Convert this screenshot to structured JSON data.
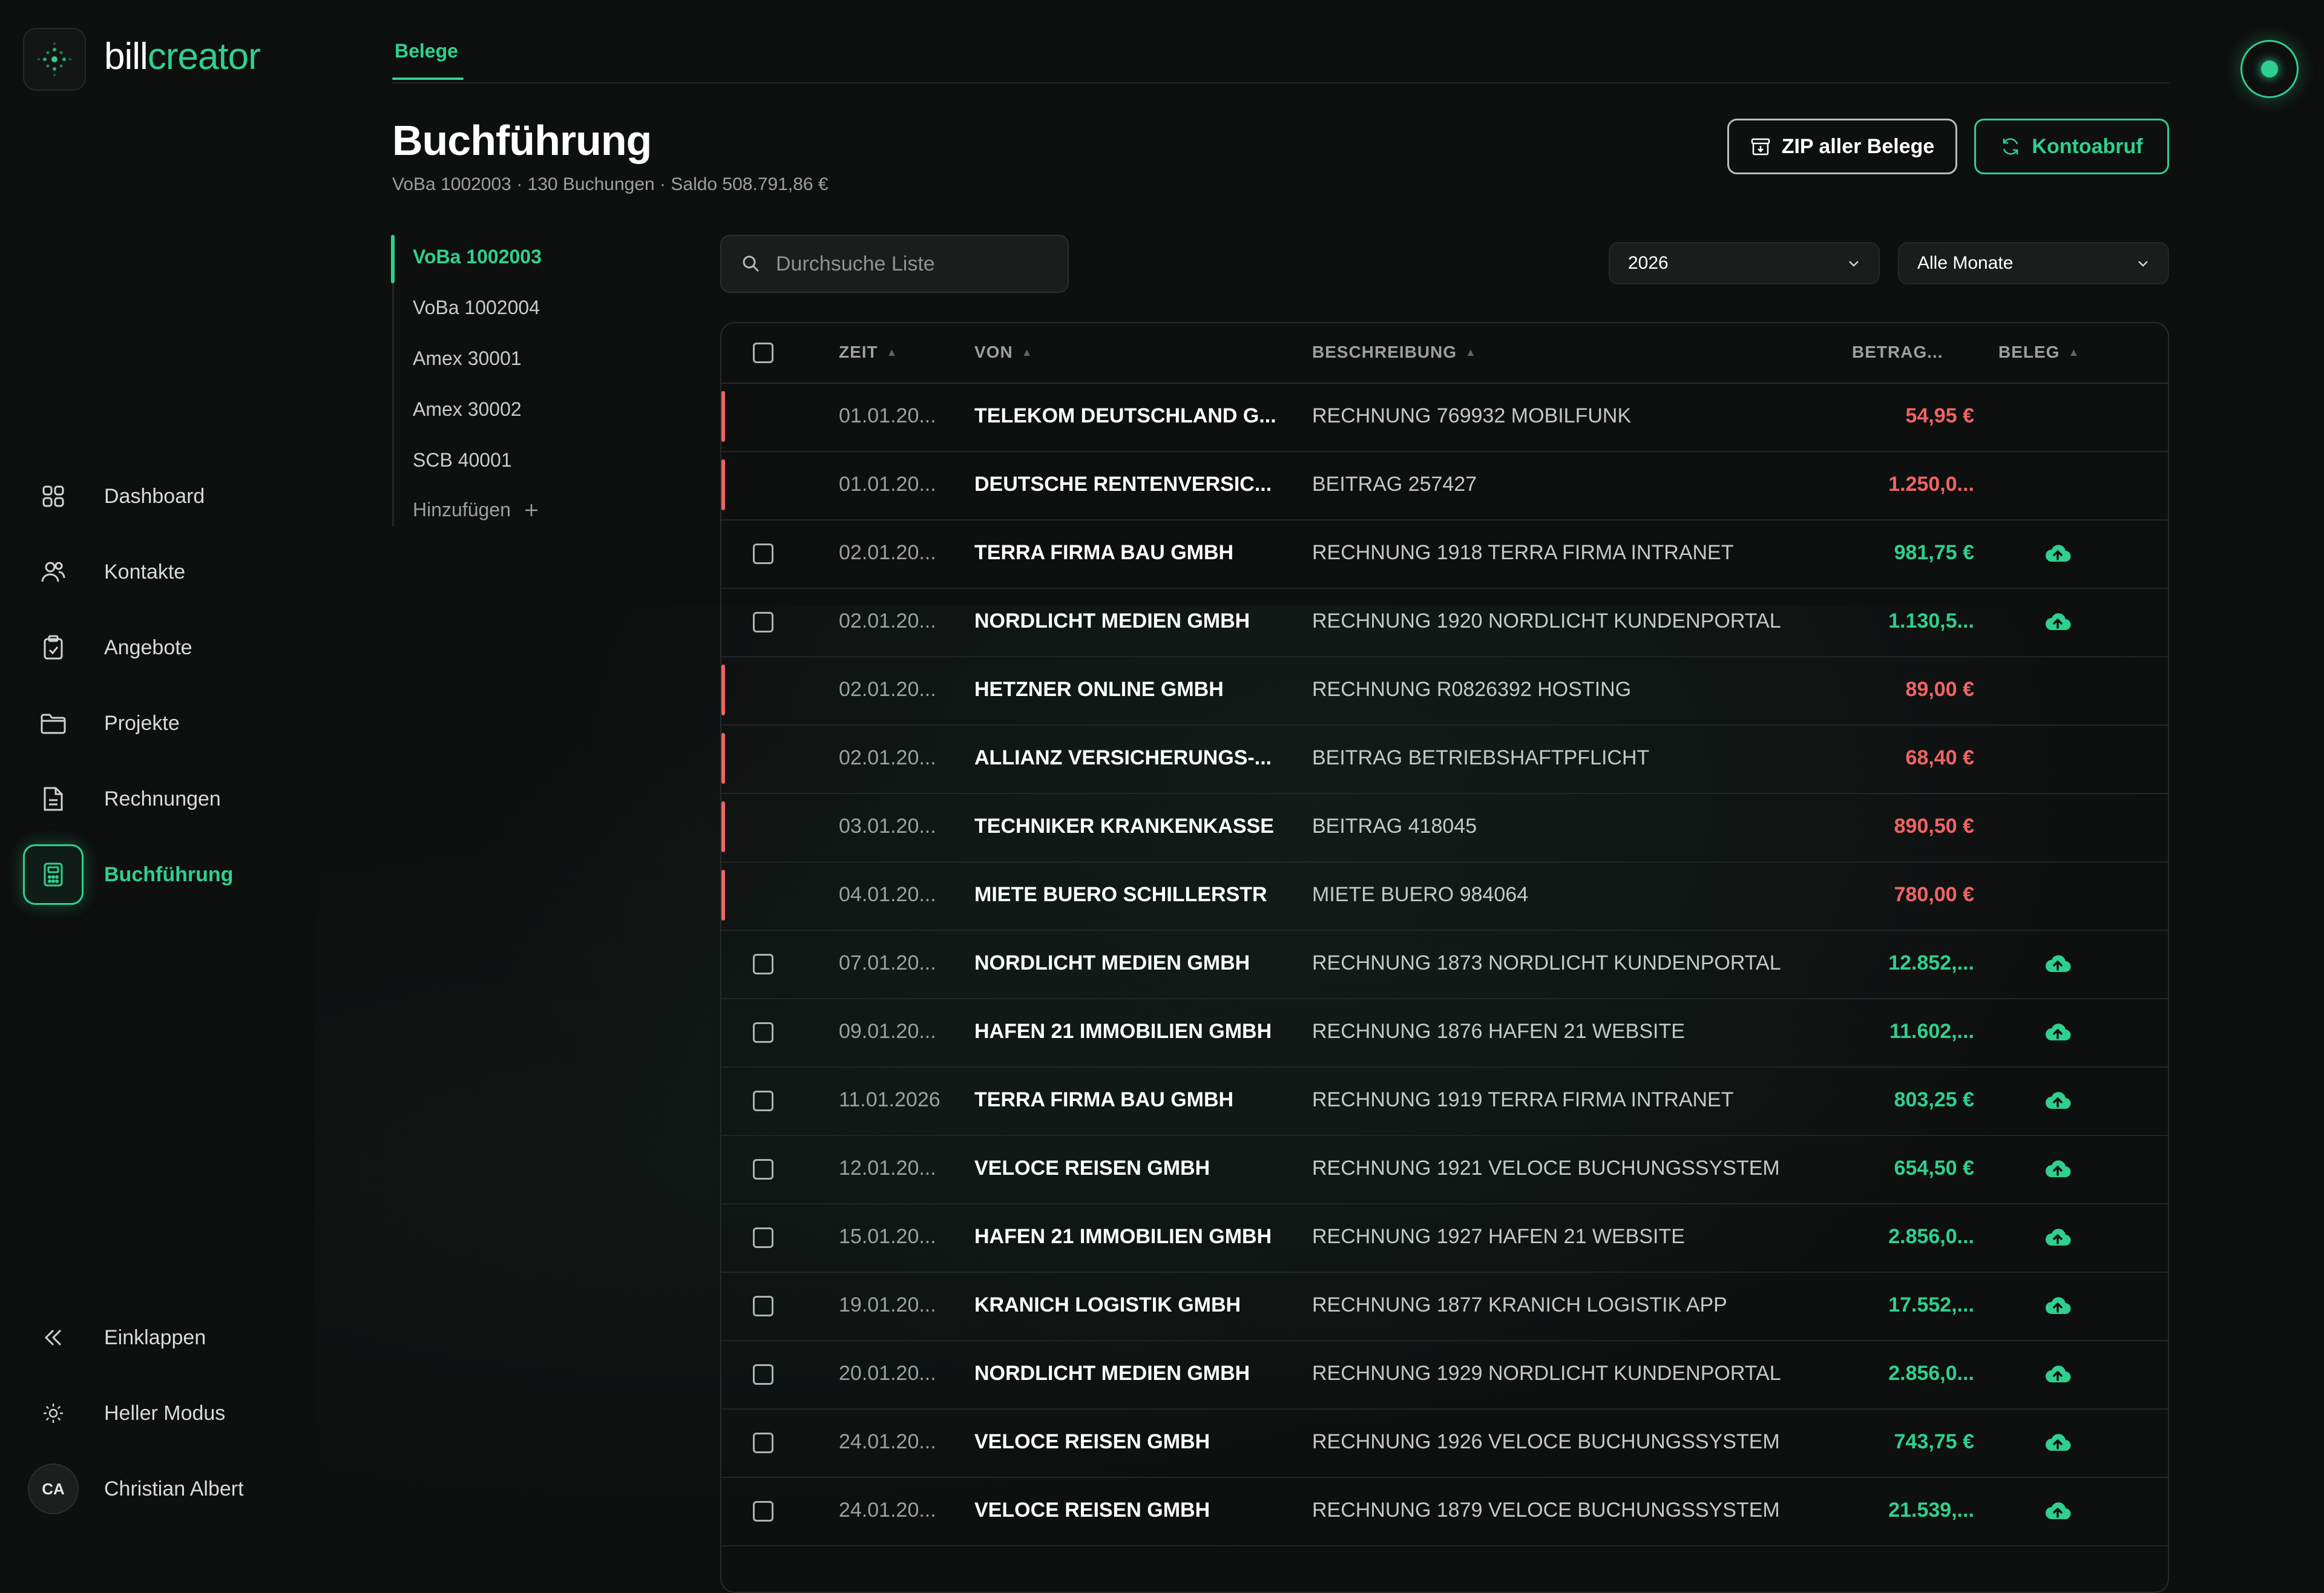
{
  "brand": {
    "part1": "bill",
    "part2": "creator"
  },
  "top_tab": "Belege",
  "page": {
    "title": "Buchführung",
    "subtitle": "VoBa 1002003 · 130 Buchungen · Saldo 508.791,86 €"
  },
  "buttons": {
    "zip": "ZIP aller Belege",
    "konto": "Kontoabruf"
  },
  "nav": [
    {
      "label": "Dashboard",
      "icon": "grid-icon"
    },
    {
      "label": "Kontakte",
      "icon": "users-icon"
    },
    {
      "label": "Angebote",
      "icon": "clipboard-icon"
    },
    {
      "label": "Projekte",
      "icon": "folder-icon"
    },
    {
      "label": "Rechnungen",
      "icon": "document-icon"
    },
    {
      "label": "Buchführung",
      "icon": "calculator-icon",
      "active": true
    }
  ],
  "bottom_nav": {
    "collapse": "Einklappen",
    "light_mode": "Heller Modus",
    "user_initials": "CA",
    "user_name": "Christian Albert"
  },
  "accounts": {
    "items": [
      "VoBa 1002003",
      "VoBa 1002004",
      "Amex 30001",
      "Amex 30002",
      "SCB 40001"
    ],
    "active_index": 0,
    "add_label": "Hinzufügen"
  },
  "search": {
    "placeholder": "Durchsuche Liste",
    "value": ""
  },
  "filters": {
    "year": "2026",
    "month": "Alle Monate"
  },
  "table": {
    "columns": [
      "ZEIT",
      "VON",
      "BESCHREIBUNG",
      "BETRAG...",
      "BELEG"
    ],
    "rows": [
      {
        "zeit": "01.01.20...",
        "von": "TELEKOM DEUTSCHLAND G...",
        "beschreibung": "RECHNUNG 769932 MOBILFUNK",
        "betrag": "54,95 €",
        "negative": true,
        "beleg": false
      },
      {
        "zeit": "01.01.20...",
        "von": "DEUTSCHE RENTENVERSIC...",
        "beschreibung": "BEITRAG 257427",
        "betrag": "1.250,0...",
        "negative": true,
        "beleg": false
      },
      {
        "zeit": "02.01.20...",
        "von": "TERRA FIRMA BAU GMBH",
        "beschreibung": "RECHNUNG 1918 TERRA FIRMA INTRANET",
        "betrag": "981,75 €",
        "negative": false,
        "beleg": true
      },
      {
        "zeit": "02.01.20...",
        "von": "NORDLICHT MEDIEN GMBH",
        "beschreibung": "RECHNUNG 1920 NORDLICHT KUNDENPORTAL",
        "betrag": "1.130,5...",
        "negative": false,
        "beleg": true
      },
      {
        "zeit": "02.01.20...",
        "von": "HETZNER ONLINE GMBH",
        "beschreibung": "RECHNUNG R0826392 HOSTING",
        "betrag": "89,00 €",
        "negative": true,
        "beleg": false
      },
      {
        "zeit": "02.01.20...",
        "von": "ALLIANZ VERSICHERUNGS-...",
        "beschreibung": "BEITRAG BETRIEBSHAFTPFLICHT",
        "betrag": "68,40 €",
        "negative": true,
        "beleg": false
      },
      {
        "zeit": "03.01.20...",
        "von": "TECHNIKER KRANKENKASSE",
        "beschreibung": "BEITRAG 418045",
        "betrag": "890,50 €",
        "negative": true,
        "beleg": false
      },
      {
        "zeit": "04.01.20...",
        "von": "MIETE BUERO SCHILLERSTR",
        "beschreibung": "MIETE BUERO 984064",
        "betrag": "780,00 €",
        "negative": true,
        "beleg": false
      },
      {
        "zeit": "07.01.20...",
        "von": "NORDLICHT MEDIEN GMBH",
        "beschreibung": "RECHNUNG 1873 NORDLICHT KUNDENPORTAL",
        "betrag": "12.852,...",
        "negative": false,
        "beleg": true
      },
      {
        "zeit": "09.01.20...",
        "von": "HAFEN 21 IMMOBILIEN GMBH",
        "beschreibung": "RECHNUNG 1876 HAFEN 21 WEBSITE",
        "betrag": "11.602,...",
        "negative": false,
        "beleg": true
      },
      {
        "zeit": "11.01.2026",
        "von": "TERRA FIRMA BAU GMBH",
        "beschreibung": "RECHNUNG 1919 TERRA FIRMA INTRANET",
        "betrag": "803,25 €",
        "negative": false,
        "beleg": true
      },
      {
        "zeit": "12.01.20...",
        "von": "VELOCE REISEN GMBH",
        "beschreibung": "RECHNUNG 1921 VELOCE BUCHUNGSSYSTEM",
        "betrag": "654,50 €",
        "negative": false,
        "beleg": true
      },
      {
        "zeit": "15.01.20...",
        "von": "HAFEN 21 IMMOBILIEN GMBH",
        "beschreibung": "RECHNUNG 1927 HAFEN 21 WEBSITE",
        "betrag": "2.856,0...",
        "negative": false,
        "beleg": true
      },
      {
        "zeit": "19.01.20...",
        "von": "KRANICH LOGISTIK GMBH",
        "beschreibung": "RECHNUNG 1877 KRANICH LOGISTIK APP",
        "betrag": "17.552,...",
        "negative": false,
        "beleg": true
      },
      {
        "zeit": "20.01.20...",
        "von": "NORDLICHT MEDIEN GMBH",
        "beschreibung": "RECHNUNG 1929 NORDLICHT KUNDENPORTAL",
        "betrag": "2.856,0...",
        "negative": false,
        "beleg": true
      },
      {
        "zeit": "24.01.20...",
        "von": "VELOCE REISEN GMBH",
        "beschreibung": "RECHNUNG 1926 VELOCE BUCHUNGSSYSTEM",
        "betrag": "743,75 €",
        "negative": false,
        "beleg": true
      },
      {
        "zeit": "24.01.20...",
        "von": "VELOCE REISEN GMBH",
        "beschreibung": "RECHNUNG 1879 VELOCE BUCHUNGSSYSTEM",
        "betrag": "21.539,...",
        "negative": false,
        "beleg": true
      }
    ]
  },
  "colors": {
    "accent": "#2fd08f",
    "negative": "#ef6464",
    "background": "#0e0f0f"
  }
}
